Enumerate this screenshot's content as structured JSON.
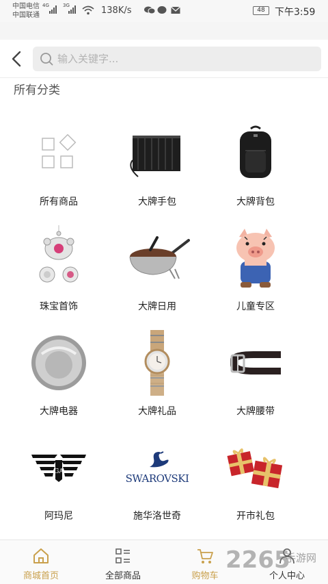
{
  "status_bar": {
    "carrier_1": "中国电信",
    "carrier_2": "中国联通",
    "net_1": "4G",
    "net_2": "3G",
    "speed": "138K/s",
    "battery": "48",
    "time": "下午3:59"
  },
  "search": {
    "placeholder": "输入关键字..."
  },
  "section_title": "所有分类",
  "categories": [
    {
      "label": "所有商品",
      "icon": "all-products-grid-icon"
    },
    {
      "label": "大牌手包",
      "icon": "clutch-bag-image"
    },
    {
      "label": "大牌背包",
      "icon": "backpack-image"
    },
    {
      "label": "珠宝首饰",
      "icon": "jewelry-image"
    },
    {
      "label": "大牌日用",
      "icon": "wok-pan-image"
    },
    {
      "label": "儿童专区",
      "icon": "piggy-doll-image"
    },
    {
      "label": "大牌电器",
      "icon": "robot-vacuum-image"
    },
    {
      "label": "大牌礼品",
      "icon": "wristwatch-image"
    },
    {
      "label": "大牌腰带",
      "icon": "belt-image"
    },
    {
      "label": "阿玛尼",
      "icon": "armani-eagle-logo"
    },
    {
      "label": "施华洛世奇",
      "icon": "swarovski-swan-logo",
      "logo_text": "SWAROVSKI"
    },
    {
      "label": "开市礼包",
      "icon": "gift-boxes-image"
    }
  ],
  "tabs": [
    {
      "label": "商城首页",
      "icon": "home-icon",
      "active": true
    },
    {
      "label": "全部商品",
      "icon": "category-list-icon",
      "active": false
    },
    {
      "label": "购物车",
      "icon": "cart-icon",
      "active": false
    },
    {
      "label": "个人中心",
      "icon": "user-icon",
      "active": false
    }
  ],
  "watermark": {
    "number": "2265",
    "text": "手游网"
  },
  "colors": {
    "accent": "#c9a04c",
    "search_bg": "#ededed"
  }
}
